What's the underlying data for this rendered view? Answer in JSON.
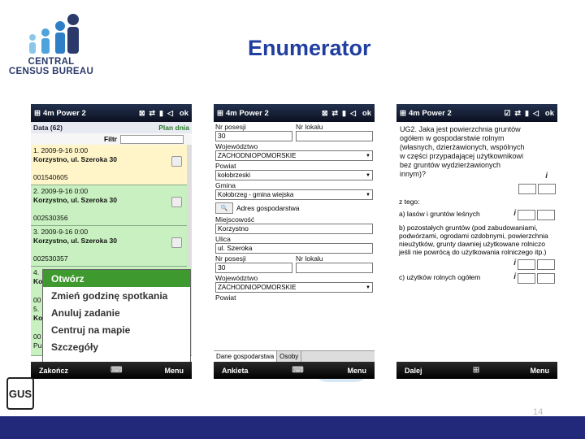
{
  "header": {
    "title": "Enumerator",
    "logo_line1": "CENTRAL",
    "logo_line2": "CENSUS BUREAU"
  },
  "phone1": {
    "app": "4m Power 2",
    "ok": "ok",
    "list_header": "Data (62)",
    "plan": "Plan dnia",
    "filter_label": "Filtr",
    "records": [
      {
        "date": "1. 2009-9-16 0:00",
        "address": "Korzystno, ul. Szeroka 30",
        "id": "001540605"
      },
      {
        "date": "2. 2009-9-16 0:00",
        "address": "Korzystno, ul. Szeroka 30",
        "id": "002530356"
      },
      {
        "date": "3. 2009-9-16 0:00",
        "address": "Korzystno, ul. Szeroka 30",
        "id": "002530357"
      }
    ],
    "partial": [
      "4.",
      "Ko",
      "00",
      "5.",
      "Ko",
      "00",
      "Pu"
    ],
    "menu": [
      "Otwórz",
      "Zmień godzinę spotkania",
      "Anuluj zadanie",
      "Centruj na mapie",
      "Szczegóły"
    ],
    "soft_left": "Zakończ",
    "soft_right": "Menu"
  },
  "phone2": {
    "app": "4m Power 2",
    "ok": "ok",
    "nr_posesji_label": "Nr posesji",
    "nr_lokalu_label": "Nr lokalu",
    "nr_posesji": "30",
    "woj_label": "Województwo",
    "woj": "ZACHODNIOPOMORSKIE",
    "powiat_label": "Powiat",
    "powiat": "kołobrzeski",
    "gmina_label": "Gmina",
    "gmina": "Kołobrzeg - gmina wiejska",
    "adres_label": "Adres gospodarstwa",
    "miejsc_label": "Miejscowość",
    "miejsc": "Korzystno",
    "ulica_label": "Ulica",
    "ulica": "ul. Szeroka",
    "nr_posesji2": "30",
    "woj2": "ZACHODNIOPOMORSKIE",
    "powiat2_label": "Powiat",
    "tab1": "Dane gospodarstwa",
    "tab2": "Osoby",
    "soft_left": "Ankieta",
    "soft_right": "Menu"
  },
  "phone3": {
    "app": "4m Power 2",
    "ok": "ok",
    "question": "UG2. Jaka jest powierzchnia gruntów ogółem w gospodarstwie rolnym (własnych, dzierżawionych, wspólnych w części przypadającej użytkownikowi bez gruntów wydzierżawionych innym)?",
    "z_tego": "z tego:",
    "opt_a": "a) lasów i gruntów leśnych",
    "opt_b": "b) pozostałych gruntów (pod zabudowaniami, podwórzami, ogrodami ozdobnymi, powierzchnia nieużytków, grunty dawniej użytkowane rolniczo jeśli nie powrócą do użytkowania rolniczego itp.)",
    "opt_c": "c) użytków rolnych ogółem",
    "soft_left": "Dalej",
    "soft_right": "Menu"
  },
  "footer": {
    "page": "14",
    "gus": "GUS"
  }
}
